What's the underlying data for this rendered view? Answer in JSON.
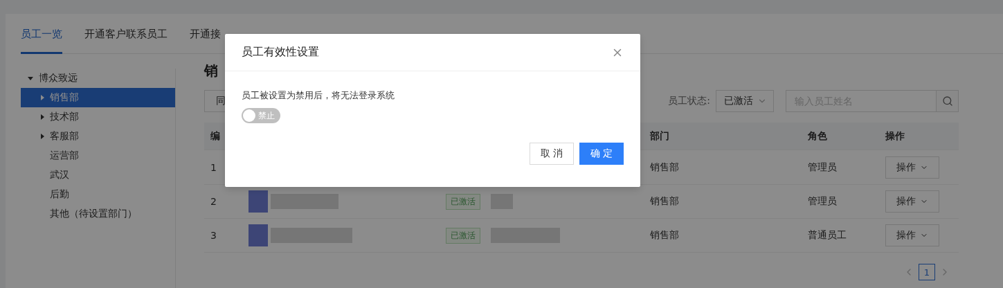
{
  "tabs": [
    {
      "label": "员工一览",
      "selected": true
    },
    {
      "label": "开通客户联系员工",
      "selected": false
    },
    {
      "label": "开通接",
      "selected": false
    }
  ],
  "tree": [
    {
      "label": "博众致远",
      "kind": "group",
      "expanded": true,
      "selected": false,
      "children": [
        {
          "label": "销售部",
          "kind": "group",
          "expanded": false,
          "selected": true
        },
        {
          "label": "技术部",
          "kind": "group",
          "expanded": false,
          "selected": false
        },
        {
          "label": "客服部",
          "kind": "group",
          "expanded": false,
          "selected": false
        },
        {
          "label": "运营部",
          "kind": "leaf",
          "selected": false
        },
        {
          "label": "武汉",
          "kind": "leaf",
          "selected": false
        },
        {
          "label": "后勤",
          "kind": "leaf",
          "selected": false
        },
        {
          "label": "其他（待设置部门）",
          "kind": "leaf",
          "selected": false
        }
      ]
    }
  ],
  "page_title": "销",
  "filter_button": "同",
  "status_filter": {
    "label": "员工状态:",
    "value": "已激活"
  },
  "search": {
    "placeholder": "输入员工姓名"
  },
  "table": {
    "columns": [
      "编",
      "部门",
      "角色",
      "操作"
    ],
    "rows": [
      {
        "number": "1",
        "department": "销售部",
        "role": "管理员",
        "action": "操作"
      },
      {
        "number": "2",
        "status": "已激活",
        "department": "销售部",
        "role": "管理员",
        "action": "操作"
      },
      {
        "number": "3",
        "status": "已激活",
        "department": "销售部",
        "role": "普通员工",
        "action": "操作"
      }
    ]
  },
  "pagination": {
    "pages": [
      {
        "label": "1",
        "selected": true
      }
    ]
  },
  "dialog": {
    "title": "员工有效性设置",
    "message": "员工被设置为禁用后，将无法登录系统",
    "switch": {
      "label": "禁止",
      "on": false
    },
    "cancel": "取 消",
    "ok": "确 定"
  }
}
